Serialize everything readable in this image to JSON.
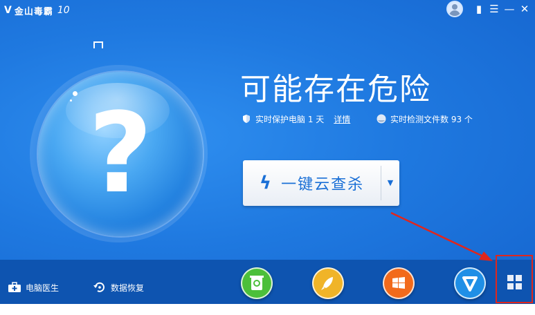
{
  "titlebar": {
    "logo_mark": "V",
    "app_name": "金山毒霸",
    "version": "10",
    "buttons": {
      "phone": "▮",
      "menu": "☰",
      "minimize": "—",
      "close": "✕"
    }
  },
  "status": {
    "title": "可能存在危险",
    "protection": {
      "text": "实时保护电脑 1 天",
      "link": "详情"
    },
    "files_checked": "实时检测文件数 93 个",
    "orb_symbol": "?"
  },
  "scan": {
    "label": "一键云查杀",
    "dropdown_arrow": "▼"
  },
  "bottom": {
    "tools": [
      {
        "label": "电脑医生",
        "icon": "medical-kit-icon"
      },
      {
        "label": "数据恢复",
        "icon": "restore-icon"
      }
    ],
    "features": [
      {
        "icon": "recycle-bin-icon",
        "color": "#4cbf3a",
        "glyph": "♻"
      },
      {
        "icon": "rocket-icon",
        "color": "#f0b428",
        "glyph": "🚀"
      },
      {
        "icon": "windows-icon",
        "color": "#f26a1b",
        "glyph": "⊞"
      },
      {
        "icon": "shield-v-icon",
        "color": "#1f8fe6",
        "glyph": "V"
      }
    ],
    "more_icon": "grid-icon"
  },
  "colors": {
    "background": "#1f79e0",
    "bottombar": "#0e54b0",
    "accent": "#1a6fd6",
    "highlight": "#e0261c"
  }
}
